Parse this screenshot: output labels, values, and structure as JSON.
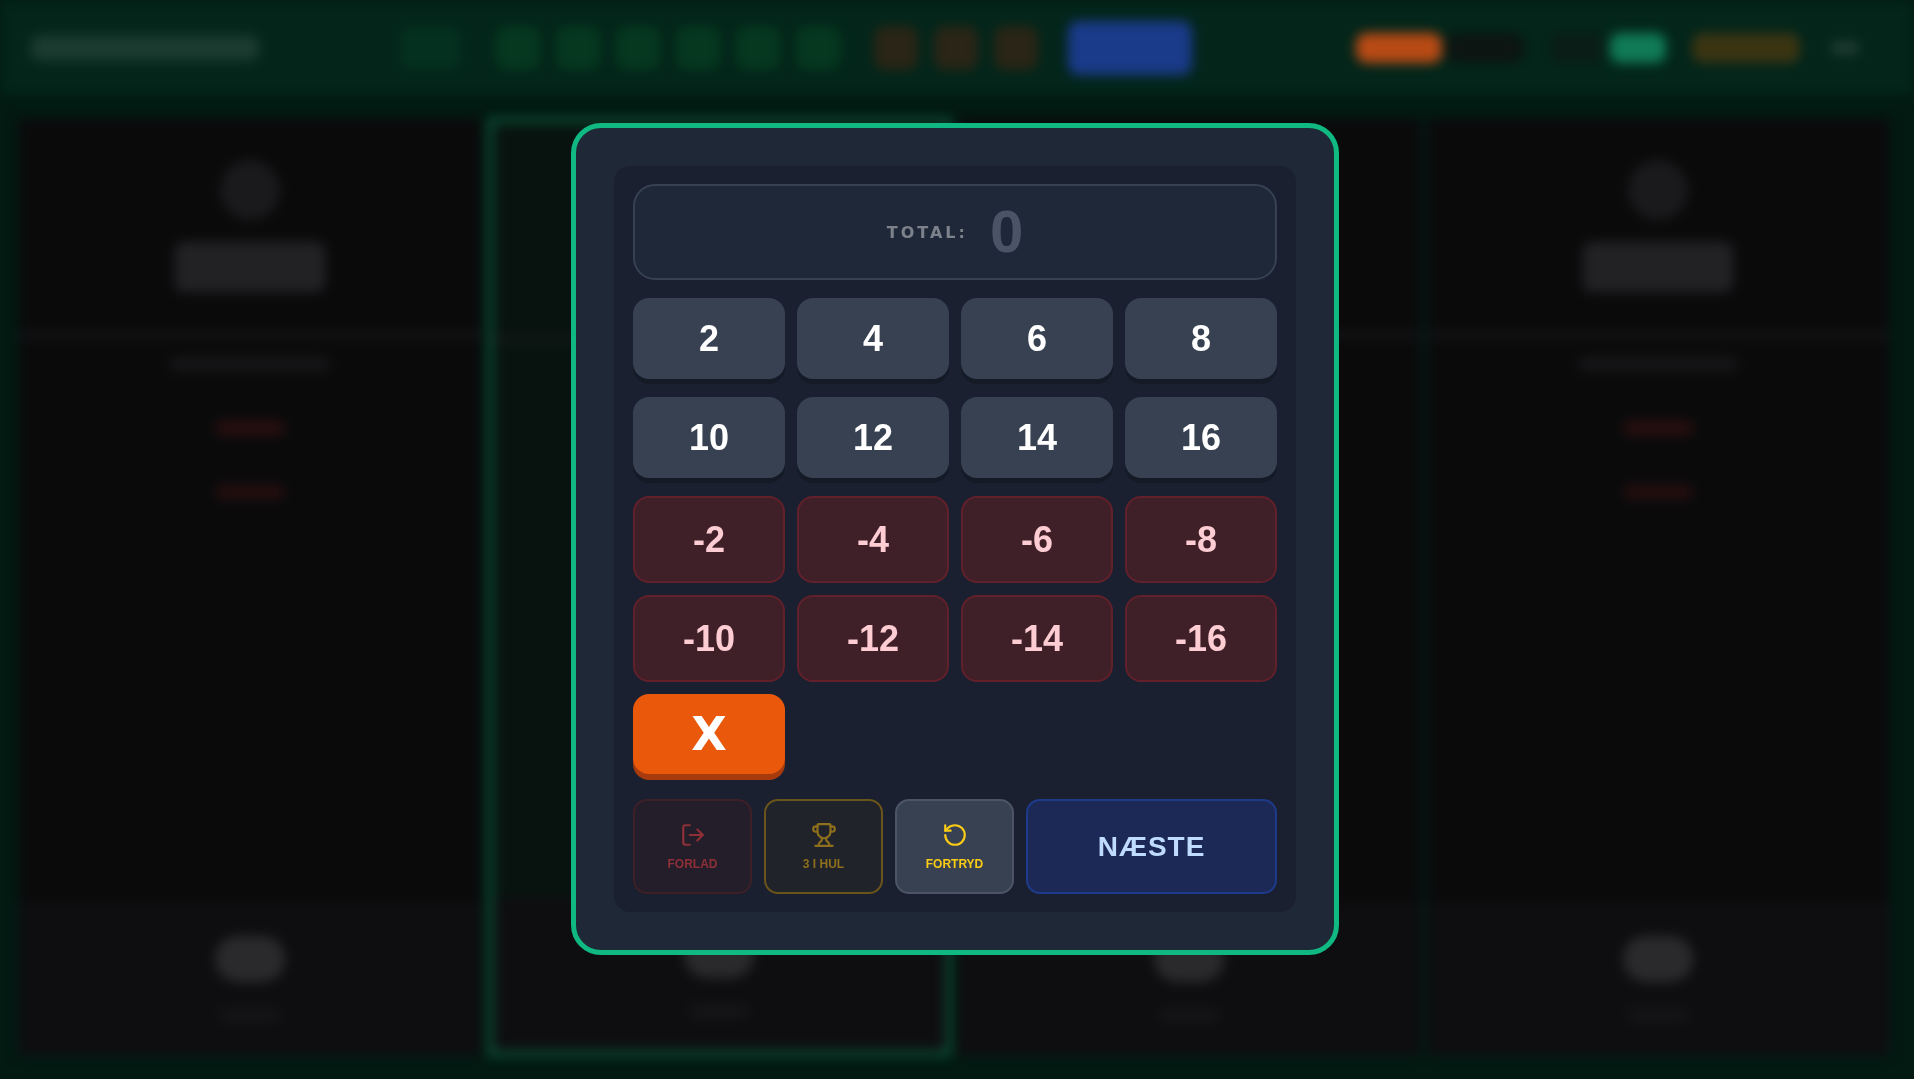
{
  "background": {
    "players": [
      {
        "selected": false
      },
      {
        "selected": true
      },
      {
        "selected": false
      },
      {
        "selected": false
      }
    ]
  },
  "score_pad": {
    "total": {
      "label": "TOTAL:",
      "value": "0"
    },
    "keys": [
      {
        "label": "2",
        "kind": "plus"
      },
      {
        "label": "4",
        "kind": "plus"
      },
      {
        "label": "6",
        "kind": "plus"
      },
      {
        "label": "8",
        "kind": "plus"
      },
      {
        "label": "10",
        "kind": "plus"
      },
      {
        "label": "12",
        "kind": "plus"
      },
      {
        "label": "14",
        "kind": "plus"
      },
      {
        "label": "16",
        "kind": "plus"
      },
      {
        "label": "-2",
        "kind": "minus"
      },
      {
        "label": "-4",
        "kind": "minus"
      },
      {
        "label": "-6",
        "kind": "minus"
      },
      {
        "label": "-8",
        "kind": "minus"
      },
      {
        "label": "-10",
        "kind": "minus"
      },
      {
        "label": "-12",
        "kind": "minus"
      },
      {
        "label": "-14",
        "kind": "minus"
      },
      {
        "label": "-16",
        "kind": "minus"
      },
      {
        "label": "X",
        "kind": "clear"
      }
    ],
    "actions": [
      {
        "label": "FORLAD",
        "kind": "leave"
      },
      {
        "label": "3 I HUL",
        "kind": "trophy"
      },
      {
        "label": "FORTRYD",
        "kind": "undo"
      },
      {
        "label": "NÆSTE",
        "kind": "next"
      }
    ]
  }
}
